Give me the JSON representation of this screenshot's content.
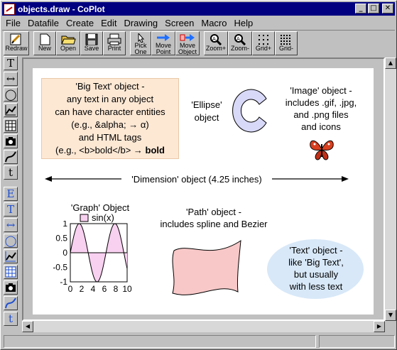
{
  "window": {
    "title": "objects.draw - CoPlot",
    "min_glyph": "_",
    "max_glyph": "□",
    "close_glyph": "✕"
  },
  "menu": [
    "File",
    "Datafile",
    "Create",
    "Edit",
    "Drawing",
    "Screen",
    "Macro",
    "Help"
  ],
  "toolbar": {
    "redraw": "Redraw",
    "new": "New",
    "open": "Open",
    "save": "Save",
    "print": "Print",
    "pick1": "Pick",
    "pick2": "One",
    "movepoint1": "Move",
    "movepoint2": "Point",
    "moveobject1": "Move",
    "moveobject2": "Object",
    "zoomin": "Zoom+",
    "zoomout": "Zoom-",
    "gridplus": "Grid+",
    "gridminus": "Grid-"
  },
  "leftbar": {
    "top": [
      "T",
      "↔",
      "◯",
      "graph",
      "chart",
      "camera",
      "path",
      "t"
    ],
    "bottom": [
      "E",
      "T",
      "↔",
      "◯",
      "graph",
      "chart",
      "camera",
      "path",
      "t"
    ]
  },
  "canvas": {
    "bigtext_lines": [
      "'Big Text' object -",
      "any text in any object",
      "can have character entities",
      "(e.g., &alpha; → α)",
      "and HTML tags",
      "(e.g., <b>bold</b> → "
    ],
    "bigtext_bold": "bold",
    "ellipse_label_1": "'Ellipse'",
    "ellipse_label_2": "object",
    "image_lines": [
      "'Image' object -",
      "includes .gif, .jpg,",
      "and .png files",
      "and icons"
    ],
    "dimension_label": "'Dimension' object (4.25 inches)",
    "graph_title": "'Graph' Object",
    "graph_legend": "sin(x)",
    "path_lines": [
      "'Path' object -",
      "includes spline and Bezier"
    ],
    "text_lines": [
      "'Text' object -",
      "like 'Big Text',",
      "but usually",
      "with less text"
    ]
  },
  "colors": {
    "bigtext_fill": "#fde8d4",
    "ellipse_fill": "#d8d8f8",
    "path_fill": "#f8c8c8",
    "text_bubble_fill": "#d8e8f8",
    "graph_fill": "#f8d0f0"
  },
  "chart_data": {
    "type": "area",
    "title": "'Graph' Object",
    "series": [
      {
        "name": "sin(x)",
        "x": [
          0,
          1,
          2,
          3,
          4,
          5,
          6,
          7,
          8,
          9,
          10
        ],
        "values": [
          0,
          0.84,
          0.91,
          0.14,
          -0.76,
          -0.96,
          -0.28,
          0.66,
          0.99,
          0.41,
          -0.54
        ]
      }
    ],
    "xlim": [
      0,
      10
    ],
    "ylim": [
      -1,
      1
    ],
    "xticks": [
      "0",
      "2",
      "4",
      "6",
      "8",
      "10"
    ],
    "yticks": [
      "1",
      "0.5",
      "0",
      "-0.5",
      "-1"
    ]
  }
}
